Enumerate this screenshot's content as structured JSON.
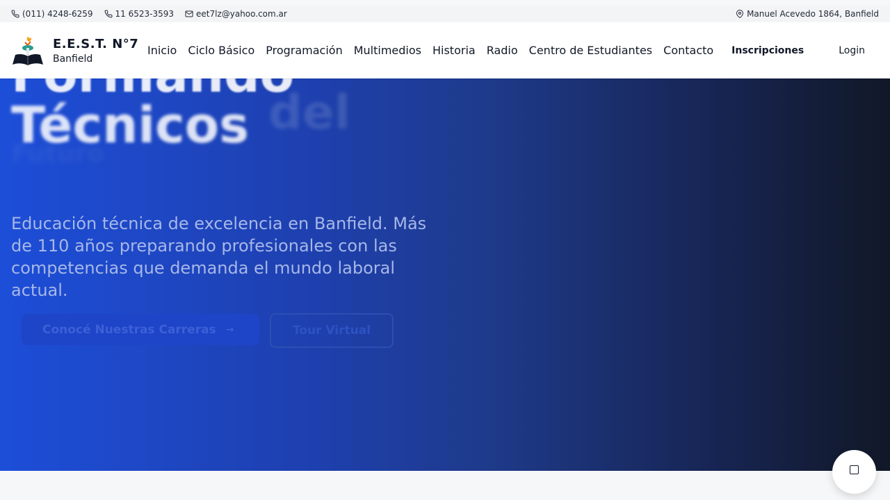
{
  "topbar": {
    "phone1": "(011) 4248-6259",
    "phone2": "11 6523-3593",
    "email": "eet7lz@yahoo.com.ar",
    "address": "Manuel Acevedo 1864, Banfield"
  },
  "header": {
    "school_name": "E.E.S.T. N°7",
    "school_location": "Banfield",
    "nav": [
      "Inicio",
      "Ciclo Básico",
      "Programación",
      "Multimedios",
      "Historia",
      "Radio",
      "Centro de Estudiantes",
      "Contacto"
    ],
    "inscripciones": "Inscripciones",
    "login": "Login"
  },
  "hero": {
    "line1": "Formando",
    "line2": "Técnicos",
    "line3": "del",
    "line4": "Futuro",
    "description": "Educación técnica de excelencia en Banfield. Más de 110 años preparando profesionales con las competencias que demanda el mundo laboral actual.",
    "primary_button": "Conocé Nuestras Carreras",
    "secondary_button": "Tour Virtual"
  },
  "icons": {
    "phone": "phone-icon",
    "email": "mail-icon",
    "address": "map-pin-icon",
    "arrow": "arrow-right-icon",
    "chat": "chat-icon"
  },
  "colors": {
    "hero_start": "#1d4ed8",
    "hero_end": "#111827",
    "header_bg": "#ffffff"
  }
}
